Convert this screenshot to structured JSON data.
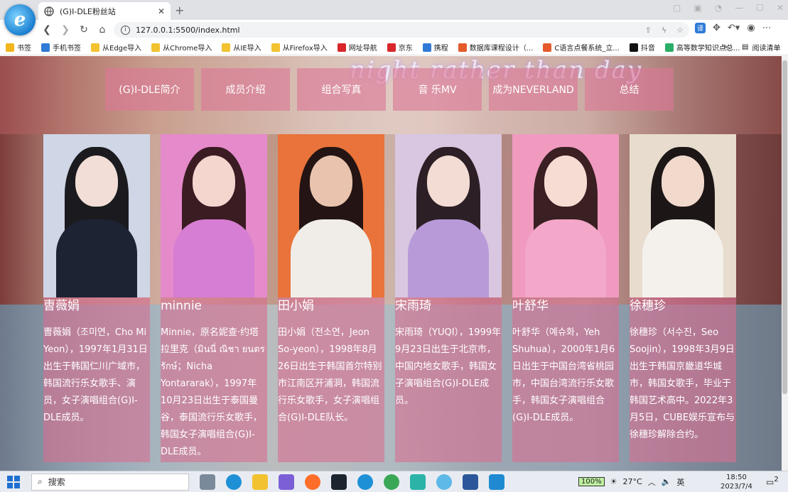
{
  "browser": {
    "tab_title": "(G)I-DLE粉丝站",
    "url": "127.0.0.1:5500/index.html",
    "bookmarks": [
      {
        "label": "书签",
        "icon": "star-icon",
        "color": "#f2b51d"
      },
      {
        "label": "手机书签",
        "icon": "phone-icon",
        "color": "#2f7ad6"
      },
      {
        "label": "从Edge导入",
        "icon": "folder-icon",
        "color": "#f2c230"
      },
      {
        "label": "从Chrome导入",
        "icon": "folder-icon",
        "color": "#f2c230"
      },
      {
        "label": "从IE导入",
        "icon": "folder-icon",
        "color": "#f2c230"
      },
      {
        "label": "从Firefox导入",
        "icon": "folder-icon",
        "color": "#f2c230"
      },
      {
        "label": "网址导航",
        "icon": "nav-icon",
        "color": "#d8262b"
      },
      {
        "label": "京东",
        "icon": "jd-icon",
        "color": "#d8262b"
      },
      {
        "label": "携程",
        "icon": "ctrip-icon",
        "color": "#2f7ad6"
      },
      {
        "label": "数据库课程设计（...",
        "icon": "c-icon",
        "color": "#e45a2a"
      },
      {
        "label": "C语言点餐系统_立...",
        "icon": "c-icon",
        "color": "#e45a2a"
      },
      {
        "label": "抖音",
        "icon": "tiktok-icon",
        "color": "#111111"
      },
      {
        "label": "高等数学知识点总...",
        "icon": "wechat-icon",
        "color": "#2aae67"
      }
    ],
    "bookmarks_more": "»",
    "reading_list": "阅读清单"
  },
  "nav": [
    {
      "label": "(G)I-DLE简介"
    },
    {
      "label": "成员介绍"
    },
    {
      "label": "组合写真"
    },
    {
      "label": "音 乐MV"
    },
    {
      "label": "成为NEVERLAND"
    },
    {
      "label": "总结"
    }
  ],
  "neon_sign": "night rather than day",
  "members": [
    {
      "name": "曺薇娟",
      "bio": "曺薇娟（조미연，Cho Mi Yeon），1997年1月31日出生于韩国仁川广域市，韩国流行乐女歌手、演员，女子演唱组合(G)I-DLE成员。",
      "photo": {
        "bg": "#cfd6e6",
        "hair": "#1b1b1f",
        "skin": "#f2ded6",
        "outfit": "#1d2333"
      }
    },
    {
      "name": "minnie",
      "bio": "Minnie，原名妮查·约塔拉里克（มินนี่ ณิชา ยนตรรักษ์；Nicha Yontararak），1997年10月23日出生于泰国曼谷，泰国流行乐女歌手，韩国女子演唱组合(G)I-DLE成员。",
      "photo": {
        "bg": "#e58acb",
        "hair": "#3a1c22",
        "skin": "#f5d6cf",
        "outfit": "#d67ed4"
      }
    },
    {
      "name": "田小娟",
      "bio": "田小娟（전소연，Jeon So-yeon），1998年8月26日出生于韩国首尔特别市江南区开浦洞，韩国流行乐女歌手，女子演唱组合(G)I-DLE队长。",
      "photo": {
        "bg": "#e9733a",
        "hair": "#241414",
        "skin": "#e9c3ad",
        "outfit": "#f0ede8"
      }
    },
    {
      "name": "宋雨琦",
      "bio": "宋雨琦（YUQI），1999年9月23日出生于北京市，中国内地女歌手，韩国女子演唱组合(G)I-DLE成员。",
      "photo": {
        "bg": "#d9c6e0",
        "hair": "#2c1f26",
        "skin": "#f3dcd4",
        "outfit": "#b89ad8"
      }
    },
    {
      "name": "叶舒华",
      "bio": "叶舒华（예슈화，Yeh Shuhua），2000年1月6日出生于中国台湾省桃园市，中国台湾流行乐女歌手，韩国女子演唱组合(G)I-DLE成员。",
      "photo": {
        "bg": "#f09ac0",
        "hair": "#3a2022",
        "skin": "#f7dcd4",
        "outfit": "#f3a8c9"
      }
    },
    {
      "name": "徐穗珍",
      "bio": "徐穗珍（서수진，Seo Soojin），1998年3月9日出生于韩国京畿道华城市，韩国女歌手，毕业于韩国艺术高中。2022年3月5日，CUBE娱乐宣布与徐穗珍解除合约。",
      "photo": {
        "bg": "#e7dccd",
        "hair": "#1c1616",
        "skin": "#f1d9cc",
        "outfit": "#f4f1ec"
      }
    }
  ],
  "taskbar": {
    "search_placeholder": "搜索",
    "battery": "100%",
    "weather": "27°C",
    "ime": "英",
    "time": "18:50",
    "date": "2023/7/4",
    "notifications": "2"
  }
}
